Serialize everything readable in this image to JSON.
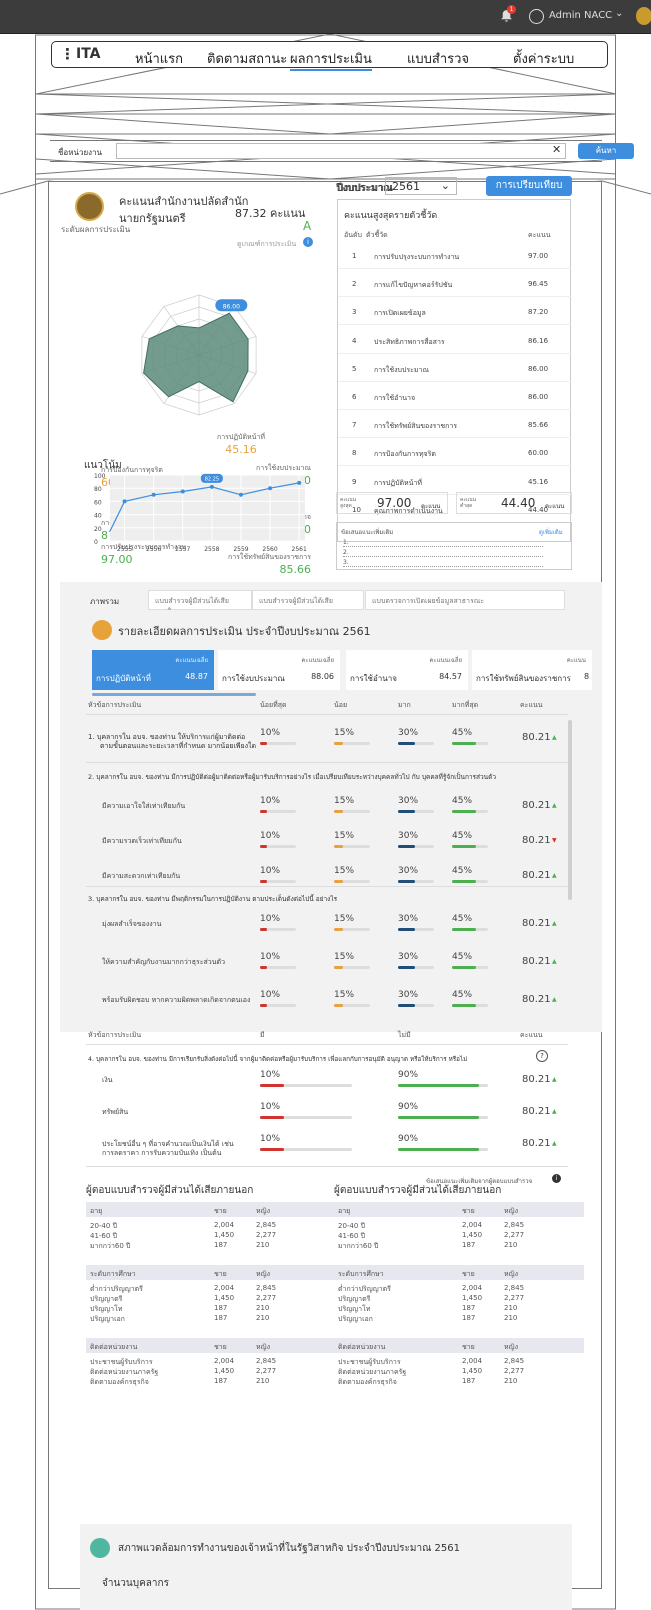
{
  "topbar": {
    "notif_count": "1",
    "user": "Admin NACC"
  },
  "nav": {
    "menu_icon": "⋮",
    "brand": "ITA",
    "items": [
      "หน้าแรก",
      "ติดตามสถานะ",
      "ผลการประเมิน",
      "แบบสำรวจ",
      "ตั้งค่าระบบ"
    ],
    "active": 2
  },
  "search": {
    "label": "ชื่อหน่วยงาน",
    "value": "",
    "button": "ค้นหา"
  },
  "agency": {
    "name_line1": "คะแนนสำนักงานปลัดสำนัก",
    "name_line2": "นายกรัฐมนตรี",
    "score": "87.32 คะแนน",
    "grade_label": "ระดับผลการประเมิน",
    "grade": "A",
    "criteria_link": "ดูเกณฑ์การประเมิน"
  },
  "year": {
    "label": "ปีงบประมาณ",
    "value": "2561",
    "compare_button": "การเปรียบเทียบ"
  },
  "radar": {
    "labels": [
      {
        "name": "การปฏิบัติหน้าที่",
        "value": "45.16"
      },
      {
        "name": "การใช้งบประมาณ",
        "value": "86.00"
      },
      {
        "name": "การใช้อำนาจ",
        "value": "86.00"
      },
      {
        "name": "การใช้ทรัพย์สินของราชการ",
        "value": "85.66"
      },
      {
        "name": "การแก้ไขปัญหาคอร์รัปชัน",
        "value": "96.45"
      },
      {
        "name": "คุณภาพการดำเนินงาน",
        "value": "44.40"
      },
      {
        "name": "ประสิทธิภาพการสื่อสาร",
        "value": "86.16"
      },
      {
        "name": "การปรับปรุงระบบการทำงาน",
        "value": "97.00"
      },
      {
        "name": "การเปิดเผยข้อมูล",
        "value": "87.20"
      },
      {
        "name": "การป้องกันการทุจริต",
        "value": "60.00"
      }
    ],
    "values": [
      45.16,
      86.0,
      86.0,
      85.66,
      96.45,
      44.4,
      86.16,
      97.0,
      87.2,
      60.0
    ],
    "tooltip": "86.00"
  },
  "ranking": {
    "title": "คะแนนสูงสุดรายตัวชี้วัด",
    "col_rank": "อันดับ",
    "col_indicator": "ตัวชี้วัด",
    "col_score": "คะแนน",
    "rows": [
      {
        "rank": "1",
        "name": "การปรับปรุงระบบการทำงาน",
        "score": "97.00"
      },
      {
        "rank": "2",
        "name": "การแก้ไขปัญหาคอร์รัปชัน",
        "score": "96.45"
      },
      {
        "rank": "3",
        "name": "การเปิดเผยข้อมูล",
        "score": "87.20"
      },
      {
        "rank": "4",
        "name": "ประสิทธิภาพการสื่อสาร",
        "score": "86.16"
      },
      {
        "rank": "5",
        "name": "การใช้งบประมาณ",
        "score": "86.00"
      },
      {
        "rank": "6",
        "name": "การใช้อำนาจ",
        "score": "86.00"
      },
      {
        "rank": "7",
        "name": "การใช้ทรัพย์สินของราชการ",
        "score": "85.66"
      },
      {
        "rank": "8",
        "name": "การป้องกันการทุจริต",
        "score": "60.00"
      },
      {
        "rank": "9",
        "name": "การปฏิบัติหน้าที่",
        "score": "45.16"
      },
      {
        "rank": "10",
        "name": "คุณภาพการดำเนินงาน",
        "score": "44.40"
      }
    ],
    "max_label": "คะแนน สูงสุด",
    "max_value": "97.00",
    "min_label": "คะแนน ต่ำสุด",
    "min_value": "44.40",
    "unit": "คะแนน"
  },
  "suggest": {
    "title": "ข้อเสนอแนะเพิ่มเติม",
    "more": "ดูเพิ่มเติม",
    "lines": [
      "1.",
      "2.",
      "3."
    ]
  },
  "chart_data": {
    "type": "line",
    "title": "แนวโน้ม",
    "x": [
      "2555",
      "2556",
      "2557",
      "2558",
      "2559",
      "2560",
      "2561"
    ],
    "values": [
      15,
      60,
      70,
      75,
      82,
      70,
      80,
      88
    ],
    "x_points": [
      "2554.5",
      "2555",
      "2556",
      "2557",
      "2558",
      "2559",
      "2560",
      "2561"
    ],
    "ylim": [
      0,
      100
    ],
    "yticks": [
      "100",
      "80",
      "60",
      "40",
      "20",
      "0"
    ],
    "tooltip": "82.25",
    "grid": true
  },
  "tabs": [
    "ภาพรวม",
    "แบบสำรวจผู้มีส่วนได้เสียภายใน",
    "แบบสำรวจผู้มีส่วนได้เสียภายนอก",
    "แบบตรวจการเปิดเผยข้อมูลสาธารณะ"
  ],
  "detail": {
    "title": "รายละเอียดผลการประเมิน ประจำปีงบประมาณ 2561",
    "cards": [
      {
        "caption": "คะแนนเฉลี่ย",
        "name": "การปฏิบัติหน้าที่",
        "value": "48.87"
      },
      {
        "caption": "คะแนนเฉลี่ย",
        "name": "การใช้งบประมาณ",
        "value": "88.06"
      },
      {
        "caption": "คะแนนเฉลี่ย",
        "name": "การใช้อำนาจ",
        "value": "84.57"
      },
      {
        "caption": "คะแนน",
        "name": "การใช้ทรัพย์สินของราชการ",
        "value": "8"
      }
    ],
    "table_headers": {
      "topic": "หัวข้อการประเมิน",
      "least": "น้อยที่สุด",
      "little": "น้อย",
      "much": "มาก",
      "most": "มากที่สุด",
      "score": "คะแนน"
    },
    "pct": {
      "a": "10%",
      "b": "15%",
      "c": "30%",
      "d": "45%"
    },
    "q1": {
      "text1": "1.  บุคลากรใน อบจ. ของท่าน ให้บริการแก่ผู้มาติดต่อ",
      "text2": "ตามขั้นตอนและระยะเวลาที่กำหนด มากน้อยเพียงใด",
      "score": "80.21"
    },
    "q2": {
      "text": "2.  บุคลากรใน อบจ. ของท่าน มีการปฏิบัติต่อผู้มาติดต่อหรือผู้มารับบริการอย่างไร เมื่อเปรียบเทียบระหว่างบุคคลทั่วไป กับ บุคคลที่รู้จักเป็นการส่วนตัว",
      "rows": [
        {
          "label": "มีความเอาใจใส่เท่าเทียมกัน",
          "score": "80.21",
          "up": true
        },
        {
          "label": "มีความรวดเร็วเท่าเทียมกัน",
          "score": "80.21",
          "up": false
        },
        {
          "label": "มีความสะดวกเท่าเทียมกัน",
          "score": "80.21",
          "up": true
        }
      ]
    },
    "q3": {
      "text": "3.  บุคลากรใน อบจ. ของท่าน มีพฤติกรรมในการปฏิบัติงาน ตามประเด็นดังต่อไปนี้ อย่างไร",
      "rows": [
        {
          "label": "มุ่งผลสำเร็จของงาน",
          "score": "80.21"
        },
        {
          "label": "ให้ความสำคัญกับงานมากกว่าธุระส่วนตัว",
          "score": "80.21"
        },
        {
          "label": "พร้อมรับผิดชอบ หากความผิดพลาดเกิดจากตนเอง",
          "score": "80.21"
        }
      ]
    },
    "yn_headers": {
      "topic": "หัวข้อการประเมิน",
      "yes": "มี",
      "no": "ไม่มี",
      "score": "คะแนน"
    },
    "q4": {
      "text": "4.  บุคลากรใน อบจ. ของท่าน มีการเรียกรับสิ่งดังต่อไปนี้ จากผู้มาติดต่อหรือผู้มารับบริการ เพื่อแลกกับการอนุมัติ อนุญาต หรือให้บริการ หรือไม่",
      "help": "?",
      "yes": "10%",
      "no": "90%",
      "rows": [
        {
          "label": "เงิน",
          "score": "80.21"
        },
        {
          "label": "ทรัพย์สิน",
          "score": "80.21"
        },
        {
          "label": "ประโยชน์อื่น ๆ ที่อาจคำนวณเป็นเงินได้ เช่น การลดราคา การรับความบันเทิง เป็นต้น",
          "score": "80.21"
        }
      ]
    },
    "footnote": "ข้อเสนอแนะเพิ่มเติมจากผู้ตอบแบบสำรวจ"
  },
  "respondents": {
    "left_title": "ผู้ตอบแบบสำรวจผู้มีส่วนได้เสียภายนอก",
    "right_title": "ผู้ตอบแบบสำรวจผู้มีส่วนได้เสียภายนอก",
    "groups": [
      {
        "h": [
          "อายุ",
          "ชาย",
          "หญิง"
        ],
        "rows": [
          [
            "20-40 ปี",
            "2,004",
            "2,845"
          ],
          [
            "41-60 ปี",
            "1,450",
            "2,277"
          ],
          [
            "มากกว่า60 ปี",
            "187",
            "210"
          ]
        ]
      },
      {
        "h": [
          "ระดับการศึกษา",
          "ชาย",
          "หญิง"
        ],
        "rows": [
          [
            "ต่ำกว่าปริญญาตรี",
            "2,004",
            "2,845"
          ],
          [
            "ปริญญาตรี",
            "1,450",
            "2,277"
          ],
          [
            "ปริญญาโท",
            "187",
            "210"
          ],
          [
            "ปริญญาเอก",
            "187",
            "210"
          ]
        ]
      },
      {
        "h": [
          "ติดต่อหน่วยงาน",
          "ชาย",
          "หญิง"
        ],
        "rows": [
          [
            "ประชาชนผู้รับบริการ",
            "2,004",
            "2,845"
          ],
          [
            "ติดต่อหน่วยงานภาครัฐ",
            "1,450",
            "2,277"
          ],
          [
            "ติดตามองค์กรธุรกิจ",
            "187",
            "210"
          ]
        ]
      }
    ]
  },
  "env": {
    "title": "สภาพแวดล้อมการทำงานของเจ้าหน้าที่ในรัฐวิสาหกิจ ประจำปีงบประมาณ 2561",
    "sub": "จำนวนบุคลากร"
  },
  "colors": {
    "accent": "#3d8ede",
    "good": "#4caf50",
    "warn": "#e8a23a",
    "bad": "#d0342c",
    "navy": "#1f4e79",
    "radar": "#5a8a7a"
  }
}
